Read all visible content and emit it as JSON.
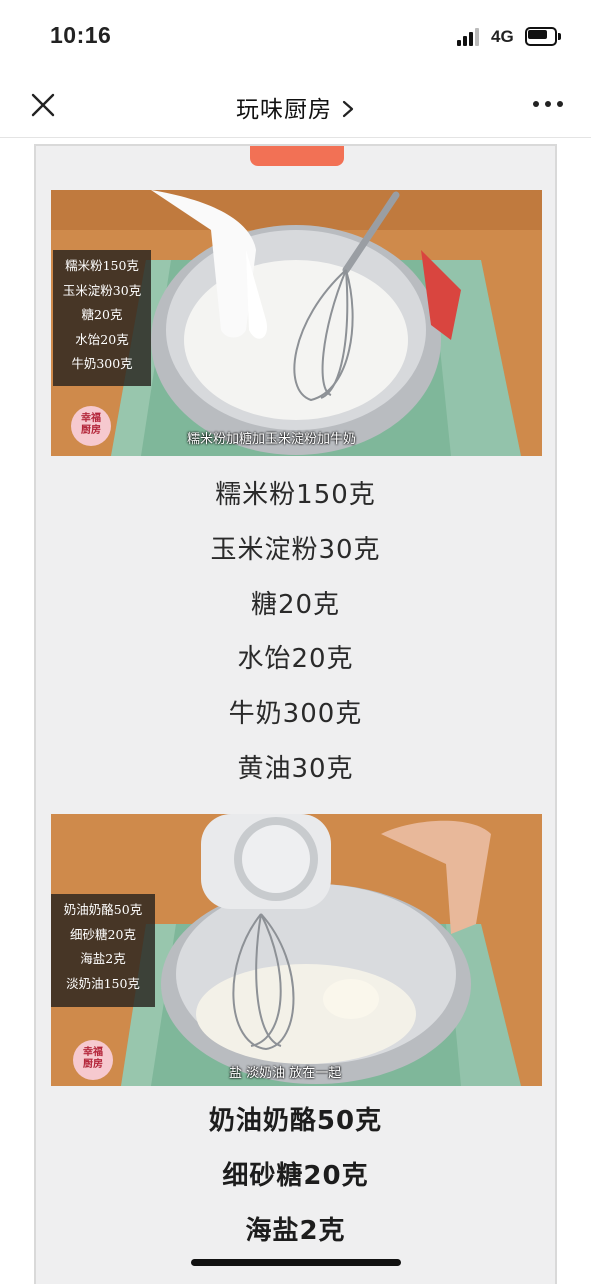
{
  "status_bar": {
    "time": "10:16",
    "network": "4G"
  },
  "nav": {
    "title": "玩味厨房"
  },
  "photo1": {
    "overlay_lines": [
      "糯米粉150克",
      "玉米淀粉30克",
      "糖20克",
      "水饴20克",
      "牛奶300克"
    ],
    "caption": "糯米粉加糖加玉米淀粉加牛奶",
    "stamp": [
      "幸福",
      "厨房"
    ]
  },
  "ingredients1": [
    "糯米粉150克",
    "玉米淀粉30克",
    "糖20克",
    "水饴20克",
    "牛奶300克",
    "黄油30克"
  ],
  "photo2": {
    "overlay_lines": [
      "奶油奶酪50克",
      "细砂糖20克",
      "海盐2克",
      "淡奶油150克"
    ],
    "caption": "盐 淡奶油 放在一起",
    "stamp": [
      "幸福",
      "厨房"
    ]
  },
  "ingredients2": [
    "奶油奶酪50克",
    "细砂糖20克",
    "海盐2克"
  ],
  "colors": {
    "tag_badge": "#f27155",
    "frame_background": "#efeff0",
    "tablecloth": "#7fb79a",
    "wood": "#d08a4a"
  },
  "icons": [
    "close-icon",
    "chevron-right-icon",
    "more-icon",
    "signal-icon",
    "battery-icon"
  ]
}
